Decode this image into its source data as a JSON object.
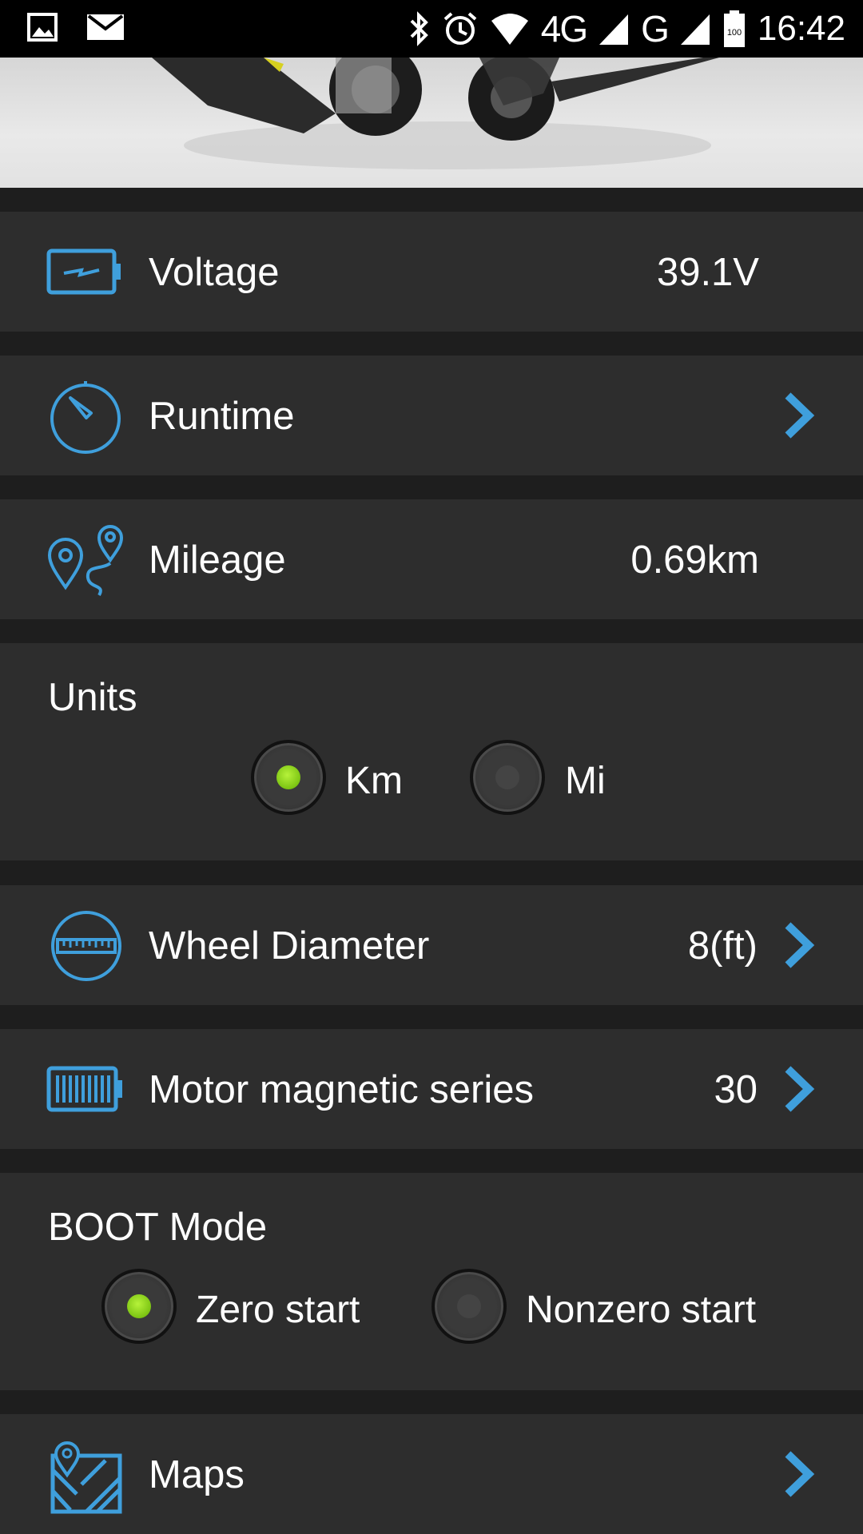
{
  "status_bar": {
    "network": "4G",
    "network2": "G",
    "battery": "100",
    "time": "16:42"
  },
  "rows": {
    "voltage": {
      "label": "Voltage",
      "value": "39.1V",
      "icon": "battery-charge-icon"
    },
    "runtime": {
      "label": "Runtime",
      "icon": "stopwatch-icon"
    },
    "mileage": {
      "label": "Mileage",
      "value": "0.69km",
      "icon": "map-pins-route-icon"
    },
    "wheel": {
      "label": "Wheel Diameter",
      "value": "8(ft)",
      "icon": "wheel-ruler-icon"
    },
    "motor": {
      "label": "Motor magnetic series",
      "value": "30",
      "icon": "battery-cells-icon"
    },
    "maps": {
      "label": "Maps",
      "icon": "map-icon"
    }
  },
  "units": {
    "title": "Units",
    "options": [
      {
        "label": "Km",
        "selected": true
      },
      {
        "label": "Mi",
        "selected": false
      }
    ]
  },
  "boot_mode": {
    "title": "BOOT Mode",
    "options": [
      {
        "label": "Zero start",
        "selected": true
      },
      {
        "label": "Nonzero start",
        "selected": false
      }
    ]
  },
  "colors": {
    "accent": "#3f9fdc",
    "radio_selected": "#8fd41c",
    "row_bg": "#2d2d2d",
    "page_bg": "#1e1e1e"
  }
}
